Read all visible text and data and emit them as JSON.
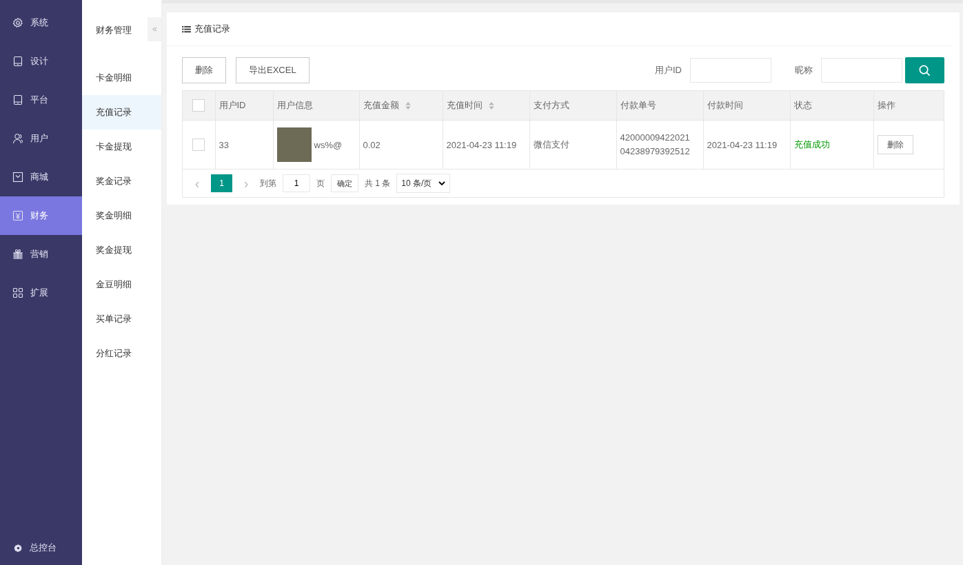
{
  "nav": {
    "items": [
      {
        "label": "系统",
        "selected": false
      },
      {
        "label": "设计",
        "selected": false
      },
      {
        "label": "平台",
        "selected": false
      },
      {
        "label": "用户",
        "selected": false
      },
      {
        "label": "商城",
        "selected": false
      },
      {
        "label": "财务",
        "selected": true
      },
      {
        "label": "营销",
        "selected": false
      },
      {
        "label": "扩展",
        "selected": false
      }
    ],
    "footer": "总控台"
  },
  "submenu": {
    "title": "财务管理",
    "items": [
      {
        "label": "卡金明细",
        "selected": false
      },
      {
        "label": "充值记录",
        "selected": true
      },
      {
        "label": "卡金提现",
        "selected": false
      },
      {
        "label": "奖金记录",
        "selected": false
      },
      {
        "label": "奖金明细",
        "selected": false
      },
      {
        "label": "奖金提现",
        "selected": false
      },
      {
        "label": "金豆明细",
        "selected": false
      },
      {
        "label": "买单记录",
        "selected": false
      },
      {
        "label": "分红记录",
        "selected": false
      }
    ]
  },
  "card": {
    "title": "充值记录"
  },
  "toolbar": {
    "buttons": [
      "删除",
      "导出EXCEL"
    ],
    "filters": [
      {
        "label": "用户ID"
      },
      {
        "label": "昵称"
      }
    ]
  },
  "table": {
    "all_checked": false,
    "columns": [
      {
        "label": "用户ID",
        "sortable": false
      },
      {
        "label": "用户信息",
        "sortable": false
      },
      {
        "label": "充值金额",
        "sortable": true
      },
      {
        "label": "充值时间",
        "sortable": true
      },
      {
        "label": "支付方式",
        "sortable": false
      },
      {
        "label": "付款单号",
        "sortable": false
      },
      {
        "label": "付款时间",
        "sortable": false
      },
      {
        "label": "状态",
        "sortable": false
      },
      {
        "label": "操作",
        "sortable": false
      }
    ],
    "rows": [
      {
        "checked": false,
        "user_id": "33",
        "nickname": "ws%@",
        "amount": "0.02",
        "time": "2021-04-23 11:19",
        "pay_method": "微信支付",
        "pay_no": [
          "42000009422021",
          "04238979392512"
        ],
        "pay_time": "2021-04-23 11:19",
        "status": "充值成功",
        "succeeded": true,
        "action": "删除"
      }
    ]
  },
  "pagination": {
    "prev": "‹",
    "pages": [
      {
        "label": "1",
        "selected": true
      }
    ],
    "next": "›",
    "goto": "到第",
    "page_value": "1",
    "page_unit": "页",
    "confirm": "确定",
    "total": "共 1 条",
    "page_size": "10 条/页"
  }
}
